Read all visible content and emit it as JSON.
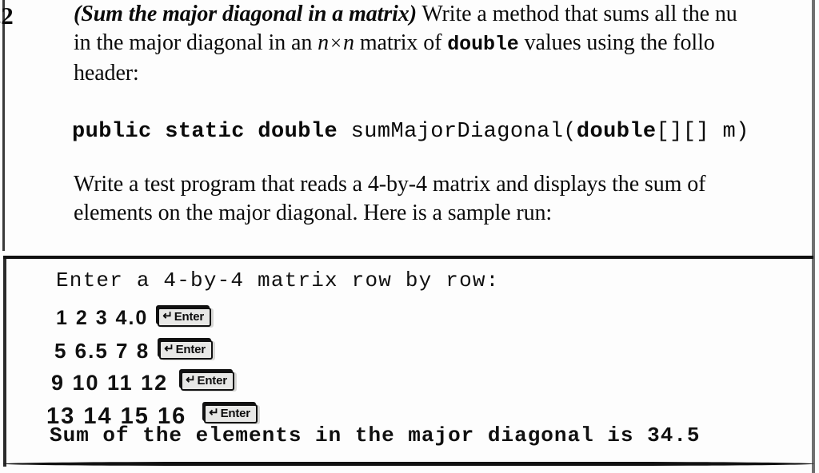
{
  "exercise": {
    "number": ".2",
    "title": "(Sum the major diagonal in a matrix)",
    "body_line1_before": "Write a method that sums all the nu",
    "body_line2_a": "in the major diagonal in an ",
    "body_line2_var1": "n",
    "body_line2_times": "×",
    "body_line2_var2": "n",
    "body_line2_b": " matrix of ",
    "body_line2_code": "double",
    "body_line2_c": " values using the follo",
    "body_line3": "header:",
    "signature_part1": "public static double ",
    "signature_part2": "sumMajorDiagonal(",
    "signature_part3": "double",
    "signature_part4": "[][] m)",
    "body2_line1": "Write a test program that reads a 4-by-4 matrix and displays the sum of",
    "body2_line2": "elements on the major diagonal. Here is a sample run:"
  },
  "sample_run": {
    "prompt": "Enter a 4-by-4 matrix row by row:",
    "input_rows": [
      {
        "numbers": "1 2 3 4.0",
        "key_label": "Enter",
        "key_arrow": "↵"
      },
      {
        "numbers": "5 6.5 7 8",
        "key_label": "Enter",
        "key_arrow": "↵"
      },
      {
        "numbers": "9 10 11 12",
        "key_label": "Enter",
        "key_arrow": "↵"
      },
      {
        "numbers": "13 14 15 16",
        "key_label": "Enter",
        "key_arrow": "↵"
      }
    ],
    "result": "Sum of the elements in the major diagonal is 34.5"
  }
}
